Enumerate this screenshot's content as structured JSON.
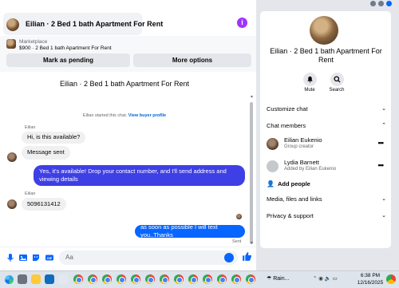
{
  "chat": {
    "header_title": "Eilian · 2 Bed 1 bath Apartment For Rent",
    "listing_sub": "Marketplace",
    "listing_title": "$900 · 2 Bed 1 bath Apartment For Rent",
    "mark_pending_label": "Mark as pending",
    "more_options_label": "More options",
    "conversation_title": "Eilian · 2 Bed 1 bath Apartment For Rent",
    "started_text": "Eilian started this chat.",
    "view_buyer_profile": "View buyer profile",
    "messages": [
      {
        "sender": "Eilian",
        "text": "Hi, is this available?"
      },
      {
        "text": "Message sent"
      },
      {
        "text": "Yes, it's available! Drop your contact number, and I'll send address and viewing details"
      },
      {
        "sender": "Eilian",
        "text": "5096131412"
      },
      {
        "text": "as soon as possible I will text you..Thanks"
      }
    ],
    "sent_label": "Sent",
    "composer_placeholder": "Aa"
  },
  "panel": {
    "title": "Eilian · 2 Bed 1 bath Apartment For Rent",
    "actions": [
      {
        "label": "Mute",
        "icon": "bell-icon"
      },
      {
        "label": "Search",
        "icon": "search-icon"
      }
    ],
    "customize_chat": "Customize chat",
    "chat_members": "Chat members",
    "members": [
      {
        "name": "Eilian Eukenio",
        "role": "Group creator"
      },
      {
        "name": "Lydia Barnett",
        "role": "Added by Eilian Eukenio"
      }
    ],
    "add_people": "Add people",
    "media_files_links": "Media, files and links",
    "privacy_support": "Privacy & support"
  },
  "taskbar": {
    "weather": "Rain...",
    "time": "6:38 PM",
    "date": "12/16/2025"
  },
  "colors": {
    "accent": "#0866ff",
    "outgoing_bubble": "#3f3fe6",
    "info_icon": "#a033ff"
  }
}
